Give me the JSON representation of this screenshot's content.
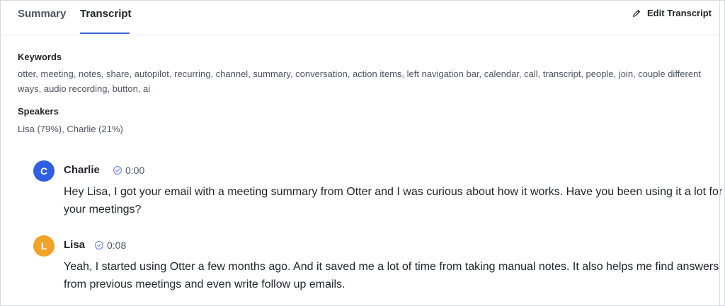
{
  "tabs": {
    "summary": "Summary",
    "transcript": "Transcript",
    "edit": "Edit Transcript"
  },
  "keywords": {
    "title": "Keywords",
    "text": "otter, meeting, notes, share, autopilot, recurring, channel, summary, conversation, action items, left navigation bar, calendar, call, transcript, people, join, couple different ways, audio recording, button, ai"
  },
  "speakers": {
    "title": "Speakers",
    "text": "Lisa (79%), Charlie (21%)"
  },
  "transcript": [
    {
      "initial": "C",
      "speaker": "Charlie",
      "time": "0:00",
      "text": "Hey Lisa, I got your email with a meeting summary from Otter and I was curious about how it works. Have you been using it a lot for your meetings?"
    },
    {
      "initial": "L",
      "speaker": "Lisa",
      "time": "0:08",
      "text": "Yeah, I started using Otter a few months ago. And it saved me a lot of time from taking manual notes. It also helps me find answers from previous meetings and even write follow up emails."
    }
  ],
  "colors": {
    "accent": "#3f66d9",
    "charlie_avatar": "#2f5ee0",
    "lisa_avatar": "#f2a227"
  },
  "icons": {
    "edit": "pencil-icon",
    "verified": "check-circle-icon"
  }
}
